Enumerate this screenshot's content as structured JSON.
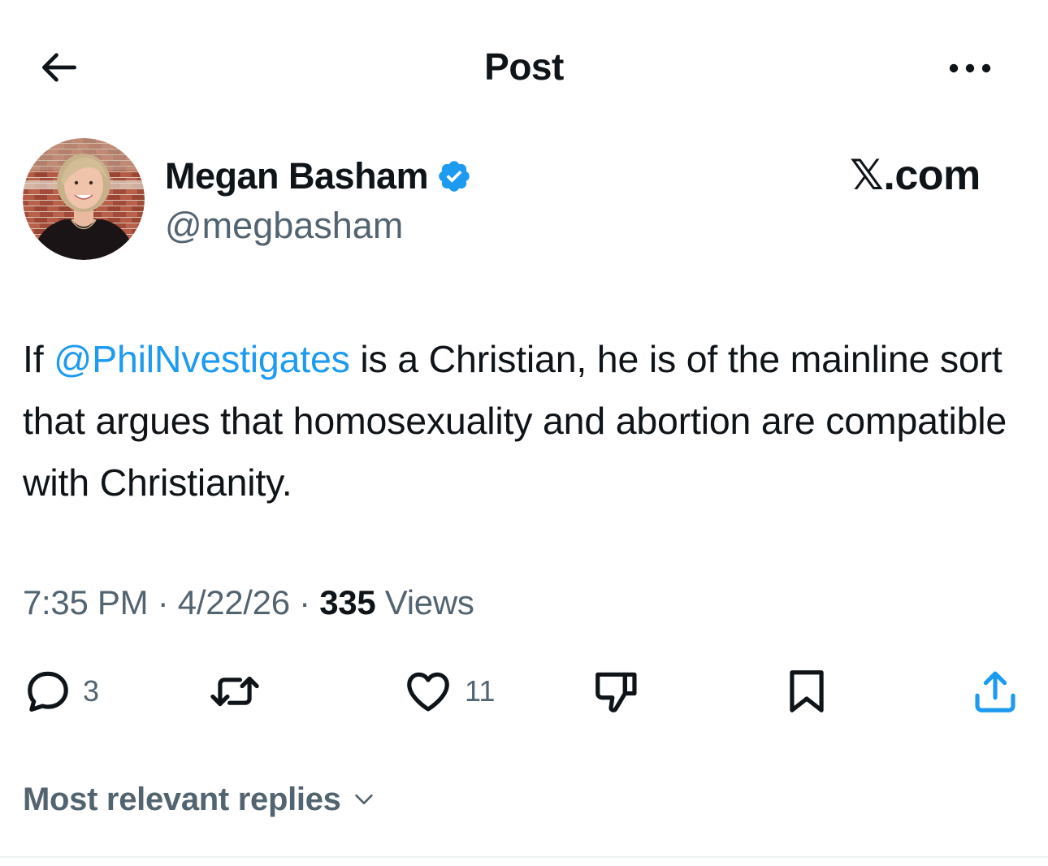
{
  "header": {
    "title": "Post",
    "back_icon": "arrow-left-icon",
    "more_icon": "more-horizontal-icon"
  },
  "author": {
    "name": "Megan Basham",
    "handle": "@megbasham",
    "verified": true,
    "verified_color": "#1d9bf0"
  },
  "watermark": {
    "text": "𝕏.com"
  },
  "tweet": {
    "prefix": "If ",
    "mention": "@PhilNvestigates",
    "suffix": " is a Christian, he is of the mainline sort that argues that homosexuality and abortion are compatible with Christianity."
  },
  "meta": {
    "time": "7:35 PM",
    "separator": " · ",
    "date": "4/22/26",
    "views_count": "335",
    "views_label": " Views"
  },
  "actions": {
    "reply": {
      "icon": "reply-icon",
      "count": "3"
    },
    "repost": {
      "icon": "repost-icon",
      "count": ""
    },
    "like": {
      "icon": "heart-icon",
      "count": "11"
    },
    "dislike": {
      "icon": "thumbs-down-icon",
      "count": ""
    },
    "bookmark": {
      "icon": "bookmark-icon",
      "count": ""
    },
    "share": {
      "icon": "share-icon",
      "count": ""
    }
  },
  "replies": {
    "sort_label": "Most relevant replies"
  },
  "colors": {
    "text_primary": "#0f1419",
    "text_secondary": "#536471",
    "accent": "#1d9bf0",
    "divider": "#eff3f4"
  }
}
